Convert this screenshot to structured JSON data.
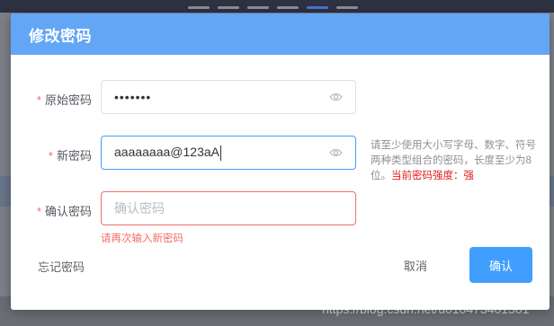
{
  "dialog": {
    "title": "修改密码"
  },
  "form": {
    "old_password": {
      "required_mark": "*",
      "label": "原始密码",
      "value": "•••••••",
      "icon": "eye-icon"
    },
    "new_password": {
      "required_mark": "*",
      "label": "新密码",
      "value": "aaaaaaaa@123aA",
      "icon": "eye-icon"
    },
    "confirm_password": {
      "required_mark": "*",
      "label": "确认密码",
      "placeholder": "确认密码",
      "error": "请再次输入新密码"
    },
    "hint": {
      "text": "请至少使用大小写字母、数字、符号两种类型组合的密码，长度至少为8位。",
      "strength": "当前密码强度：强"
    }
  },
  "footer": {
    "forgot_label": "忘记密码",
    "cancel_label": "取消",
    "confirm_label": "确认"
  },
  "watermark": "https://blog.csdn.net/u010473401501",
  "colors": {
    "header": "#63a6f6",
    "primary": "#409eff",
    "error": "#f56c6c",
    "strength": "#e02020"
  }
}
